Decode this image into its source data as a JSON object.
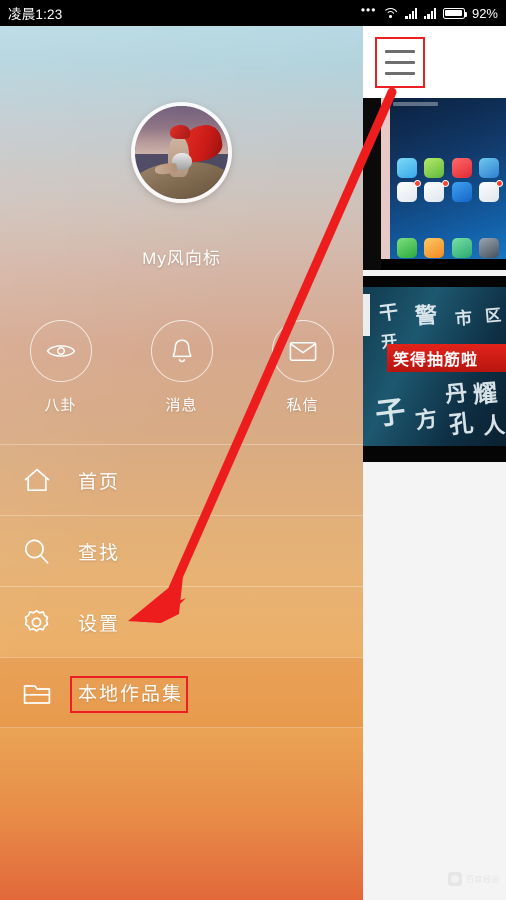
{
  "status_bar": {
    "time": "凌晨1:23",
    "dots": "•••",
    "wifi_icon": "wifi-icon",
    "signal_icon_1": "signal-bars-icon",
    "signal_icon_2": "signal-bars-icon",
    "battery_icon": "battery-icon",
    "battery_percent": "92%"
  },
  "drawer": {
    "profile": {
      "avatar_icon": "user-avatar-photo",
      "username": "My风向标"
    },
    "actions": [
      {
        "id": "gossip",
        "label": "八卦",
        "icon": "eye-icon"
      },
      {
        "id": "message",
        "label": "消息",
        "icon": "bell-icon"
      },
      {
        "id": "dm",
        "label": "私信",
        "icon": "envelope-icon"
      }
    ],
    "menu": [
      {
        "id": "home",
        "label": "首页",
        "icon": "home-icon",
        "highlighted": false
      },
      {
        "id": "search",
        "label": "查找",
        "icon": "search-icon",
        "highlighted": false
      },
      {
        "id": "settings",
        "label": "设置",
        "icon": "gear-icon",
        "highlighted": false
      },
      {
        "id": "local-works",
        "label": "本地作品集",
        "icon": "folder-icon",
        "highlighted": true
      }
    ]
  },
  "right_pane": {
    "hamburger_icon": "hamburger-menu-icon",
    "thumbnails": [
      {
        "id": "thumb-home",
        "caption": "手机桌面截图缩略图"
      },
      {
        "id": "thumb-meme",
        "caption": "笑得抽筋啦"
      }
    ],
    "meme_banner_text": "笑得抽筋啦",
    "meme_chars": [
      "干",
      "警",
      "市",
      "区",
      "开",
      "丹",
      "耀",
      "子",
      "方",
      "孔",
      "人"
    ],
    "watermark_text": "百度经验"
  },
  "annotations": {
    "highlight_box_color": "#ec2024",
    "arrow_color": "#ee1d1d",
    "arrow_label": "red-arrow-from-hamburger-to-local-works"
  },
  "colors": {
    "drawer_top": "#b7d9e3",
    "drawer_mid": "#d6a98f",
    "drawer_bottom": "#e2683a",
    "accent_red": "#ec2024",
    "status_bar_bg": "#000000",
    "text_white": "#ffffff"
  }
}
